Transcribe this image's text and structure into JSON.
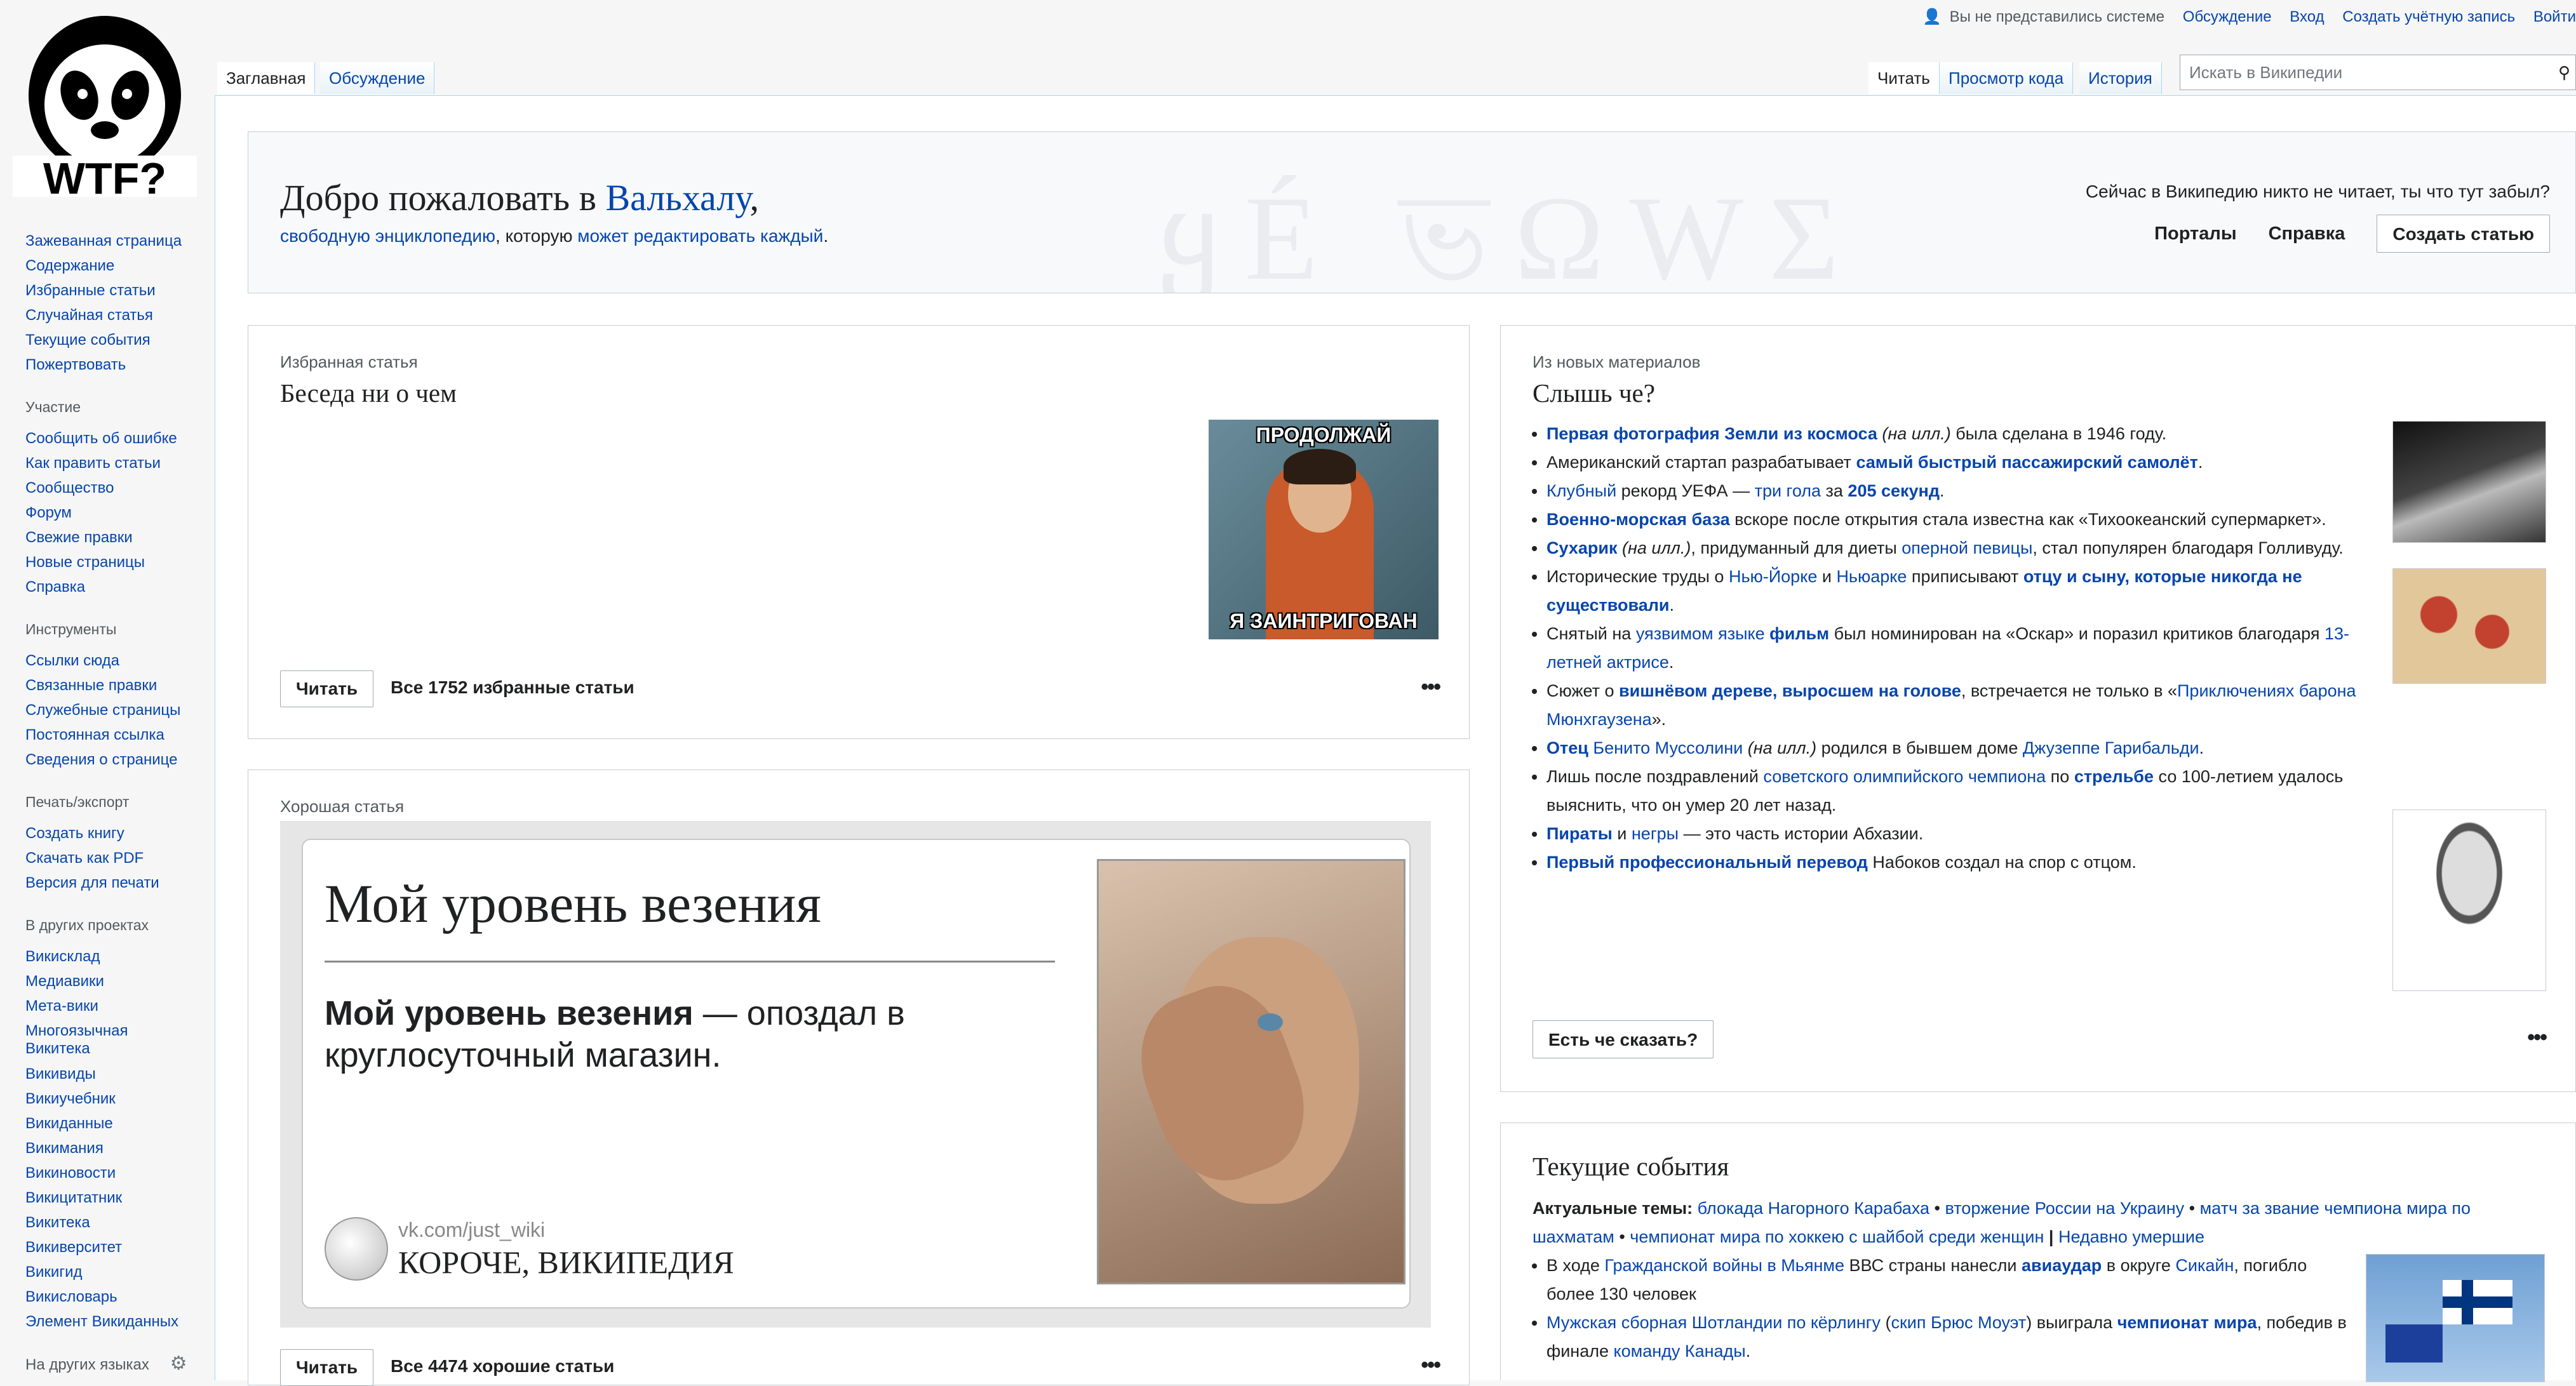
{
  "logo": {
    "text": "WTF?"
  },
  "personal": {
    "not_logged": "Вы не представились системе",
    "discussion": "Обсуждение",
    "login": "Вход",
    "create_account": "Создать учётную запись",
    "login2": "Войти"
  },
  "sidebar": {
    "main": [
      "Зажеванная страница",
      "Содержание",
      "Избранные статьи",
      "Случайная статья",
      "Текущие события",
      "Пожертвовать"
    ],
    "participation_head": "Участие",
    "participation": [
      "Сообщить об ошибке",
      "Как править статьи",
      "Сообщество",
      "Форум",
      "Свежие правки",
      "Новые страницы",
      "Справка"
    ],
    "tools_head": "Инструменты",
    "tools": [
      "Ссылки сюда",
      "Связанные правки",
      "Служебные страницы",
      "Постоянная ссылка",
      "Сведения о странице"
    ],
    "print_head": "Печать/экспорт",
    "print": [
      "Создать книгу",
      "Скачать как PDF",
      "Версия для печати"
    ],
    "projects_head": "В других проектах",
    "projects": [
      "Викисклад",
      "Медиавики",
      "Мета-вики",
      "Многоязычная Викитека",
      "Викивиды",
      "Викиучебник",
      "Викиданные",
      "Викимания",
      "Викиновости",
      "Викицитатник",
      "Викитека",
      "Викиверситет",
      "Викигид",
      "Викисловарь",
      "Элемент Викиданных"
    ],
    "langs": "На других языках"
  },
  "tabs": {
    "main": "Заглавная",
    "talk": "Обсуждение",
    "read": "Читать",
    "source": "Просмотр кода",
    "history": "История"
  },
  "search": {
    "placeholder": "Искать в Википедии"
  },
  "banner": {
    "welcome_prefix": "Добро пожаловать в ",
    "welcome_link": "Вальхалу",
    "welcome_suffix": ",",
    "sub_link1": "свободную энциклопедию",
    "sub_mid": ", которую ",
    "sub_link2": "может редактировать каждый",
    "sub_end": ".",
    "tagline": "Сейчас в Википедию никто не читает, ты что тут забыл?",
    "portals": "Порталы",
    "help": "Справка",
    "create": "Создать статью"
  },
  "featured": {
    "label": "Избранная статья",
    "title": "Беседа ни о чем",
    "image_top": "ПРОДОЛЖАЙ",
    "image_bottom": "Я ЗАИНТРИГОВАН",
    "read": "Читать",
    "all": "Все 1752 избранные статьи",
    "more": "•••"
  },
  "good": {
    "label": "Хорошая статья",
    "heading": "Мой уровень везения",
    "body_bold": "Мой уровень везения",
    "body_rest": " — опоздал в круглосуточный магазин.",
    "vk": "vk.com/just_wiki",
    "brand": "КОРОЧЕ, ВИКИПЕДИЯ",
    "read": "Читать",
    "all": "Все 4474 хорошие статьи",
    "more": "•••"
  },
  "dyk": {
    "label": "Из новых материалов",
    "title": "Слышь че?",
    "items": [
      [
        {
          "t": "Первая фотография Земли из космоса",
          "c": "lb"
        },
        {
          "t": " "
        },
        {
          "t": "(на илл.)",
          "c": "i"
        },
        {
          "t": " была сделана в 1946 году."
        }
      ],
      [
        {
          "t": "Американский стартап разрабатывает "
        },
        {
          "t": "самый быстрый пассажирский самолёт",
          "c": "lb"
        },
        {
          "t": "."
        }
      ],
      [
        {
          "t": "Клубный",
          "c": "l"
        },
        {
          "t": " рекорд УЕФА — "
        },
        {
          "t": "три гола",
          "c": "l"
        },
        {
          "t": " за "
        },
        {
          "t": "205 секунд",
          "c": "lb"
        },
        {
          "t": "."
        }
      ],
      [
        {
          "t": "Военно-морская база",
          "c": "lb"
        },
        {
          "t": " вскоре после открытия стала известна как «Тихоокеанский супермаркет»."
        }
      ],
      [
        {
          "t": "Сухарик",
          "c": "lb"
        },
        {
          "t": " "
        },
        {
          "t": "(на илл.)",
          "c": "i"
        },
        {
          "t": ", придуманный для диеты "
        },
        {
          "t": "оперной певицы",
          "c": "l"
        },
        {
          "t": ", стал популярен благодаря Голливуду."
        }
      ],
      [
        {
          "t": "Исторические труды о "
        },
        {
          "t": "Нью-Йорке",
          "c": "l"
        },
        {
          "t": " и "
        },
        {
          "t": "Ньюарке",
          "c": "l"
        },
        {
          "t": " приписывают "
        },
        {
          "t": "отцу и сыну, которые никогда не существовали",
          "c": "lb"
        },
        {
          "t": "."
        }
      ],
      [
        {
          "t": "Снятый на "
        },
        {
          "t": "уязвимом языке",
          "c": "l"
        },
        {
          "t": " "
        },
        {
          "t": "фильм",
          "c": "lb"
        },
        {
          "t": " был номинирован на «Оскар» и поразил критиков благодаря "
        },
        {
          "t": "13-летней актрисе",
          "c": "l"
        },
        {
          "t": "."
        }
      ],
      [
        {
          "t": "Сюжет о "
        },
        {
          "t": "вишнёвом дереве, выросшем на голове",
          "c": "lb"
        },
        {
          "t": ", встречается не только в «"
        },
        {
          "t": "Приключениях барона Мюнхгаузена",
          "c": "l"
        },
        {
          "t": "»."
        }
      ],
      [
        {
          "t": "Отец",
          "c": "lb"
        },
        {
          "t": " "
        },
        {
          "t": "Бенито Муссолини",
          "c": "l"
        },
        {
          "t": " "
        },
        {
          "t": "(на илл.)",
          "c": "i"
        },
        {
          "t": " родился в бывшем доме "
        },
        {
          "t": "Джузеппе Гарибальди",
          "c": "l"
        },
        {
          "t": "."
        }
      ],
      [
        {
          "t": "Лишь после поздравлений "
        },
        {
          "t": "советского олимпийского чемпиона",
          "c": "l"
        },
        {
          "t": " по "
        },
        {
          "t": "стрельбе",
          "c": "lb"
        },
        {
          "t": " со 100-летием удалось выяснить, что он умер 20 лет назад."
        }
      ],
      [
        {
          "t": "Пираты",
          "c": "lb"
        },
        {
          "t": " и "
        },
        {
          "t": "негры",
          "c": "l"
        },
        {
          "t": " — это часть истории Абхазии."
        }
      ],
      [
        {
          "t": "Первый профессиональный перевод",
          "c": "lb"
        },
        {
          "t": " Набоков создал на спор с отцом."
        }
      ]
    ],
    "button": "Есть че сказать?",
    "more": "•••"
  },
  "news": {
    "title": "Текущие события",
    "topics_label": "Актуальные темы:",
    "topics": [
      "блокада Нагорного Карабаха",
      "вторжение России на Украину",
      "матч за звание чемпиона мира по шахматам",
      "чемпионат мира по хоккею с шайбой среди женщин"
    ],
    "recent": "Недавно умершие",
    "items": [
      [
        {
          "t": "В ходе "
        },
        {
          "t": "Гражданской войны в Мьянме",
          "c": "l"
        },
        {
          "t": " ВВС страны нанесли "
        },
        {
          "t": "авиаудар",
          "c": "lb"
        },
        {
          "t": " в округе "
        },
        {
          "t": "Сикайн",
          "c": "l"
        },
        {
          "t": ", погибло более 130 человек"
        }
      ],
      [
        {
          "t": "Мужская сборная Шотландии по кёрлингу",
          "c": "l"
        },
        {
          "t": " ("
        },
        {
          "t": "скип Брюс Моуэт",
          "c": "l"
        },
        {
          "t": ") выиграла "
        },
        {
          "t": "чемпионат мира",
          "c": "lb"
        },
        {
          "t": ", победив в финале "
        },
        {
          "t": "команду Канады",
          "c": "l"
        },
        {
          "t": "."
        }
      ]
    ]
  }
}
